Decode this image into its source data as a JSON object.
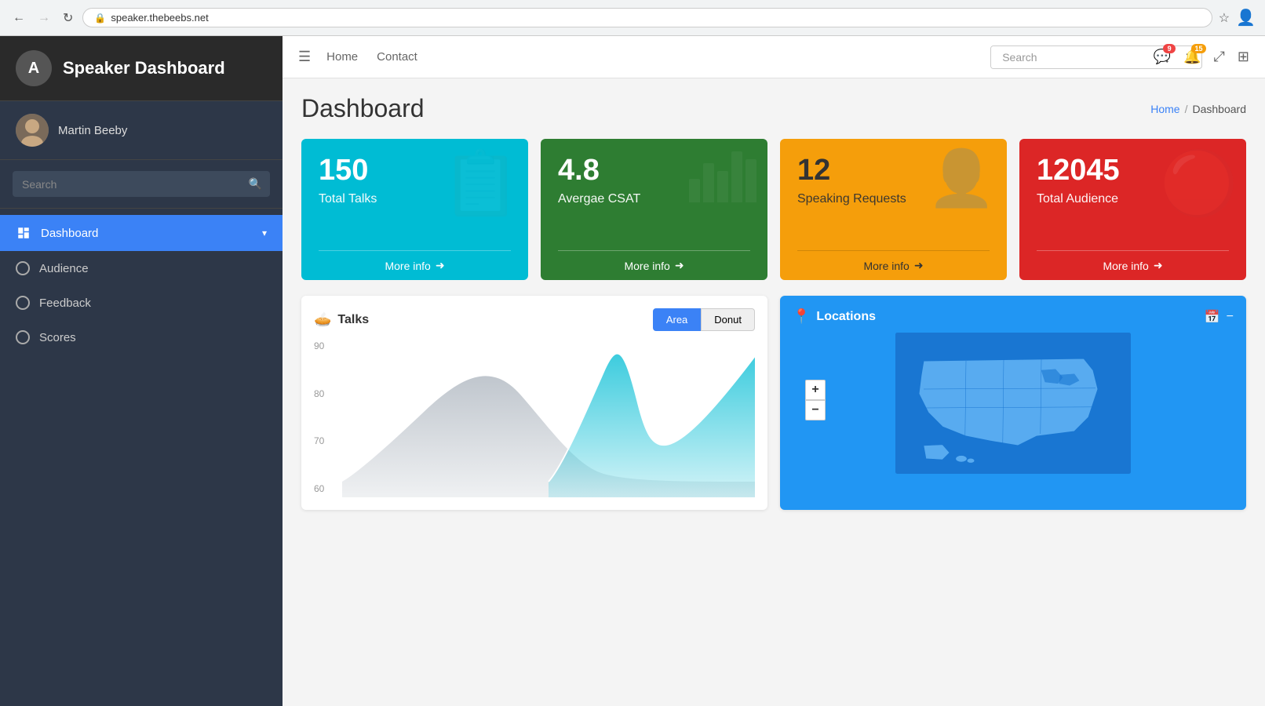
{
  "browser": {
    "url": "speaker.thebeebs.net",
    "back_disabled": false,
    "forward_disabled": true
  },
  "sidebar": {
    "logo_letter": "A",
    "title": "Speaker Dashboard",
    "user_name": "Martin Beeby",
    "search_placeholder": "Search",
    "nav_items": [
      {
        "id": "dashboard",
        "label": "Dashboard",
        "type": "icon",
        "active": true
      },
      {
        "id": "audience",
        "label": "Audience",
        "type": "radio",
        "active": false
      },
      {
        "id": "feedback",
        "label": "Feedback",
        "type": "radio",
        "active": false
      },
      {
        "id": "scores",
        "label": "Scores",
        "type": "radio",
        "active": false
      }
    ]
  },
  "topbar": {
    "hamburger_label": "☰",
    "nav_links": [
      "Home",
      "Contact"
    ],
    "search_placeholder": "Search",
    "messages_badge": "9",
    "notifications_badge": "15"
  },
  "page": {
    "title": "Dashboard",
    "breadcrumb_home": "Home",
    "breadcrumb_current": "Dashboard"
  },
  "stat_cards": [
    {
      "id": "total-talks",
      "value": "150",
      "label": "Total Talks",
      "more_info": "More info",
      "color": "teal",
      "bg_icon": "🗒"
    },
    {
      "id": "avg-csat",
      "value": "4.8",
      "label": "Avergae CSAT",
      "more_info": "More info",
      "color": "green",
      "bg_icon": "bar"
    },
    {
      "id": "speaking-requests",
      "value": "12",
      "label": "Speaking Requests",
      "more_info": "More info",
      "color": "yellow",
      "bg_icon": "👤"
    },
    {
      "id": "total-audience",
      "value": "12045",
      "label": "Total Audience",
      "more_info": "More info",
      "color": "red",
      "bg_icon": "🔵"
    }
  ],
  "talks_chart": {
    "title": "Talks",
    "btn_area": "Area",
    "btn_donut": "Donut",
    "y_labels": [
      "90",
      "80",
      "70",
      "60"
    ],
    "active_btn": "area"
  },
  "locations": {
    "title": "Locations"
  }
}
